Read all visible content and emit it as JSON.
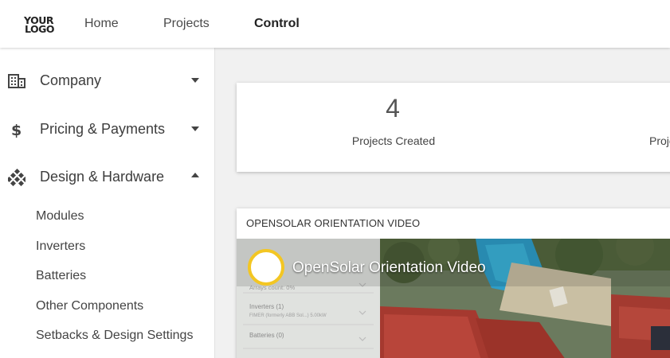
{
  "header": {
    "logo_line1": "YOUR",
    "logo_line2": "LOGO",
    "nav": [
      "Home",
      "Projects",
      "Control"
    ]
  },
  "sidebar": {
    "sections": [
      {
        "label": "Company",
        "icon": "building-icon",
        "expanded": false
      },
      {
        "label": "Pricing & Payments",
        "icon": "dollar-icon",
        "expanded": false
      },
      {
        "label": "Design & Hardware",
        "icon": "grid-diamond-icon",
        "expanded": true
      }
    ],
    "sub_items": [
      "Modules",
      "Inverters",
      "Batteries",
      "Other Components",
      "Setbacks & Design Settings"
    ]
  },
  "stats": [
    {
      "value": "4",
      "label": "Projects Created"
    },
    {
      "label": "Proje"
    }
  ],
  "video": {
    "card_title": "OPENSOLAR ORIENTATION VIDEO",
    "heading": "OpenSolar Orientation Video",
    "overlay_lines": [
      "Arrays count: 0%",
      "Inverters (1)",
      "FIMER (formerly ABB Sol...) 5.00kW",
      "Batteries (0)"
    ]
  },
  "colors": {
    "accent_ring": "#f3c623",
    "background": "#f1f1f1"
  }
}
